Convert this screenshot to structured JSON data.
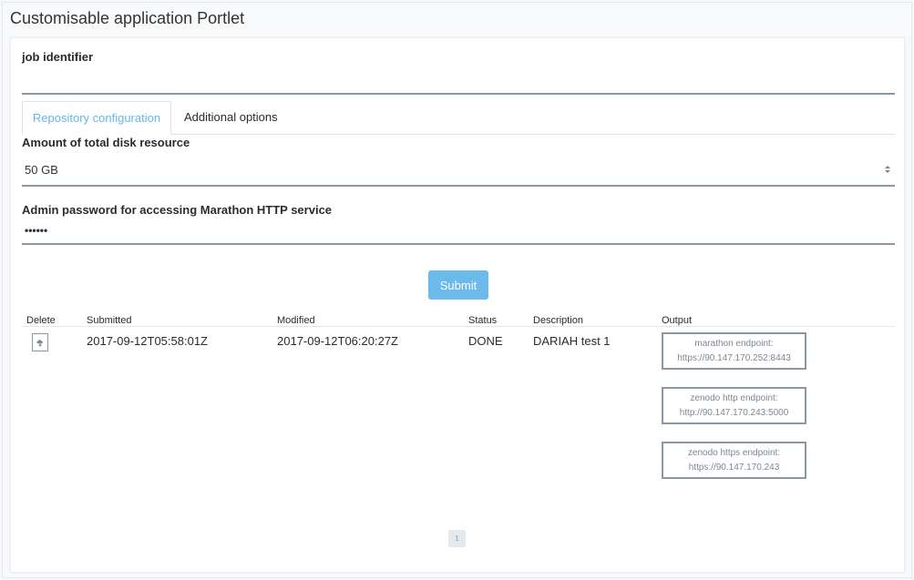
{
  "portlet": {
    "title": "Customisable application Portlet"
  },
  "form": {
    "job_identifier_label": "job identifier",
    "job_identifier_value": "",
    "tabs": [
      {
        "label": "Repository configuration",
        "active": true
      },
      {
        "label": "Additional options",
        "active": false
      }
    ],
    "disk_label": "Amount of total disk resource",
    "disk_selected": "50 GB",
    "password_label": "Admin password for accessing Marathon HTTP service",
    "password_value": "••••••",
    "submit_label": "Submit"
  },
  "jobs": {
    "headers": [
      "Delete",
      "Submitted",
      "Modified",
      "Status",
      "Description",
      "Output"
    ],
    "rows": [
      {
        "submitted": "2017-09-12T05:58:01Z",
        "modified": "2017-09-12T06:20:27Z",
        "status": "DONE",
        "description": "DARIAH test 1",
        "outputs": [
          {
            "title": "marathon endpoint:",
            "url": "https://90.147.170.252:8443"
          },
          {
            "title": "zenodo http endpoint:",
            "url": "http://90.147.170.243:5000"
          },
          {
            "title": "zenodo https endpoint:",
            "url": "https://90.147.170.243"
          }
        ]
      }
    ]
  },
  "pagination": {
    "current_page": "1"
  },
  "colors": {
    "accent": "#65b6ea",
    "input_border": "#8c98a1"
  }
}
